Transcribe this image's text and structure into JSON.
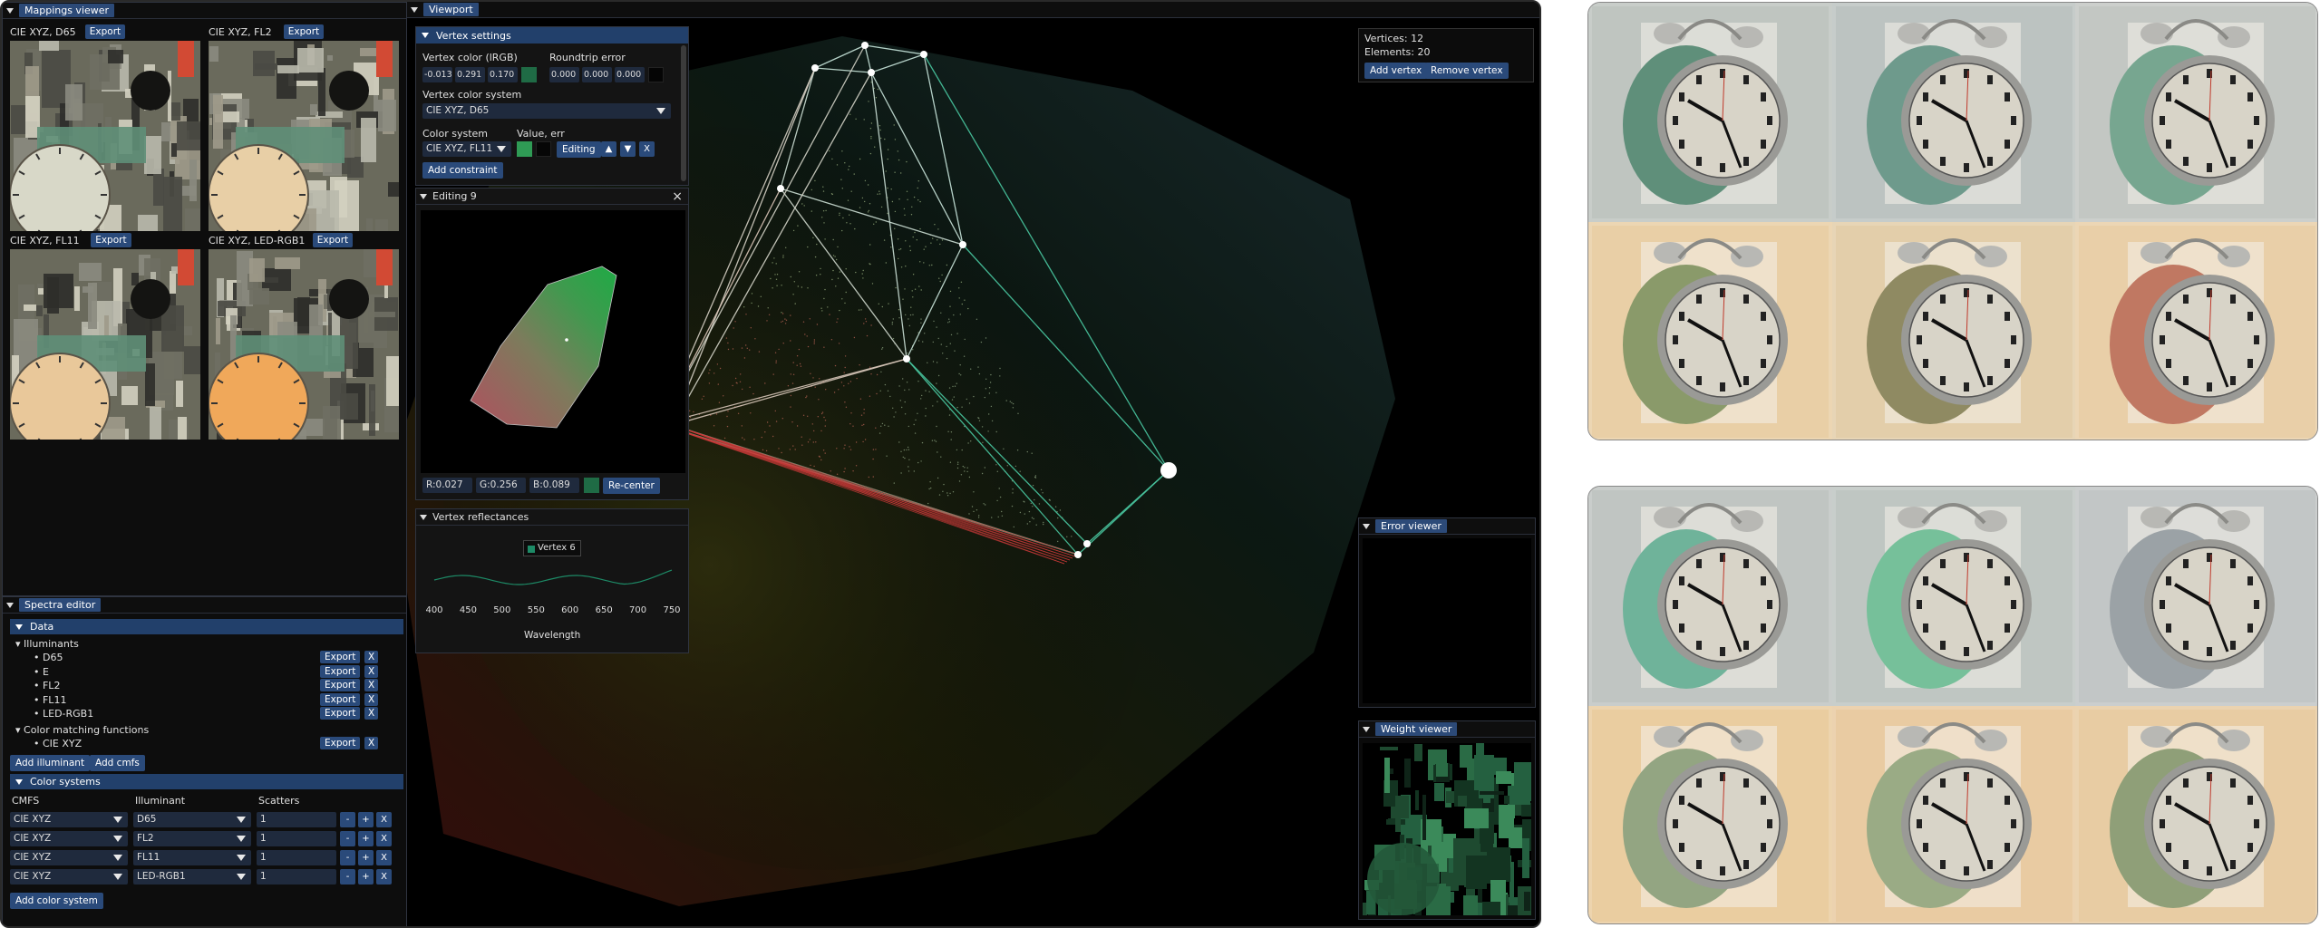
{
  "mappings_viewer": {
    "title": "Mappings viewer",
    "export_label": "Export",
    "thumbs": [
      {
        "label": "CIE XYZ, D65",
        "tint": "#d8d8c8"
      },
      {
        "label": "CIE XYZ, FL2",
        "tint": "#e8cfa6"
      },
      {
        "label": "CIE XYZ, FL11",
        "tint": "#e9c89a"
      },
      {
        "label": "CIE XYZ, LED-RGB1",
        "tint": "#f0a85a"
      }
    ]
  },
  "spectra_editor": {
    "title": "Spectra editor",
    "data_section": "Data",
    "illuminants_label": "Illuminants",
    "illuminants": [
      "D65",
      "E",
      "FL2",
      "FL11",
      "LED-RGB1"
    ],
    "cmf_label": "Color matching functions",
    "cmfs": [
      "CIE XYZ"
    ],
    "export_label": "Export",
    "remove_label": "X",
    "add_illuminant": "Add illuminant",
    "add_cmfs": "Add cmfs",
    "color_systems_section": "Color systems",
    "col_cmfs": "CMFS",
    "col_illuminant": "Illuminant",
    "col_scatters": "Scatters",
    "rows": [
      {
        "cmfs": "CIE XYZ",
        "illuminant": "D65",
        "scatters": "1"
      },
      {
        "cmfs": "CIE XYZ",
        "illuminant": "FL2",
        "scatters": "1"
      },
      {
        "cmfs": "CIE XYZ",
        "illuminant": "FL11",
        "scatters": "1"
      },
      {
        "cmfs": "CIE XYZ",
        "illuminant": "LED-RGB1",
        "scatters": "1"
      }
    ],
    "minus": "-",
    "plus": "+",
    "add_color_system": "Add color system"
  },
  "viewport": {
    "title": "Viewport",
    "vertices": "Vertices: 12",
    "elements": "Elements: 20",
    "add_vertex": "Add vertex",
    "remove_vertex": "Remove vertex"
  },
  "vertex_settings": {
    "title": "Vertex settings",
    "vertex_color_label": "Vertex color (lRGB)",
    "roundtrip_label": "Roundtrip error",
    "color_values": [
      "-0.013",
      "0.291",
      "0.170"
    ],
    "error_values": [
      "0.000",
      "0.000",
      "0.000"
    ],
    "swatch_color": "#1f6b45",
    "vcs_label": "Vertex color system",
    "vcs_value": "CIE XYZ, D65",
    "color_system_label": "Color system",
    "value_err_label": "Value, err",
    "color_system_value": "CIE XYZ, FL11",
    "editing_btn": "Editing",
    "up": "▲",
    "down": "▼",
    "close": "X",
    "add_constraint": "Add constraint"
  },
  "editing": {
    "title": "Editing 9",
    "close": "×",
    "r": "R:0.027",
    "g": "G:0.256",
    "b": "B:0.089",
    "recenter": "Re-center"
  },
  "reflectances": {
    "title": "Vertex reflectances",
    "legend": "Vertex 6",
    "ticks": [
      "400",
      "450",
      "500",
      "550",
      "600",
      "650",
      "700",
      "750"
    ],
    "xlabel": "Wavelength",
    "line_color": "#1d8a66"
  },
  "error_viewer": {
    "title": "Error viewer"
  },
  "weight_viewer": {
    "title": "Weight viewer"
  },
  "renders": {
    "top": [
      "#5f8f7a",
      "#6e9a8c",
      "#77a690",
      "#8a9a6a",
      "#8f8a62",
      "#c07862"
    ],
    "top_bg": [
      "#bfc5c0",
      "#bcc3c1",
      "#c3c7c3",
      "#e9cfa6",
      "#e3ceaa",
      "#e9cfa8"
    ],
    "bottom": [
      "#6fb39a",
      "#76c09a",
      "#9ba2a6",
      "#93a582",
      "#9aab85",
      "#8f9f78"
    ],
    "bottom_bg": [
      "#c0c5c2",
      "#bfc6c2",
      "#c2c6c6",
      "#eacda0",
      "#e9cba2",
      "#e8cca3"
    ]
  }
}
